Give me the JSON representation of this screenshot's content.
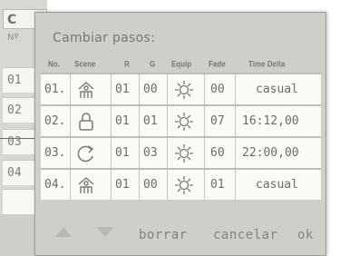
{
  "background": {
    "title": "C",
    "column_header": "Nº",
    "rows": [
      "01",
      "02",
      "03",
      "04"
    ]
  },
  "dialog": {
    "title": "Cambiar pasos:",
    "columns": [
      "No.",
      "Scene",
      "R",
      "G",
      "Equip",
      "Fade",
      "Time Delta"
    ],
    "rows": [
      {
        "no": "01.",
        "scene_icon": "person-scene-icon",
        "r": "01",
        "g": "00",
        "equip_icon": "sun-icon",
        "fade": "00",
        "time": "casual"
      },
      {
        "no": "02.",
        "scene_icon": "lock-icon",
        "r": "01",
        "g": "01",
        "equip_icon": "sun-icon",
        "fade": "07",
        "time": "16:12,00"
      },
      {
        "no": "03.",
        "scene_icon": "repeat-arrow-icon",
        "r": "01",
        "g": "03",
        "equip_icon": "sun-icon",
        "fade": "60",
        "time": "22:00,00"
      },
      {
        "no": "04.",
        "scene_icon": "person-scene-icon",
        "r": "01",
        "g": "00",
        "equip_icon": "sun-icon",
        "fade": "01",
        "time": "casual"
      }
    ],
    "footer": {
      "up_icon": "arrow-up-icon",
      "down_icon": "arrow-down-icon",
      "delete_label": "borrar",
      "cancel_label": "cancelar",
      "ok_label": "ok"
    }
  }
}
